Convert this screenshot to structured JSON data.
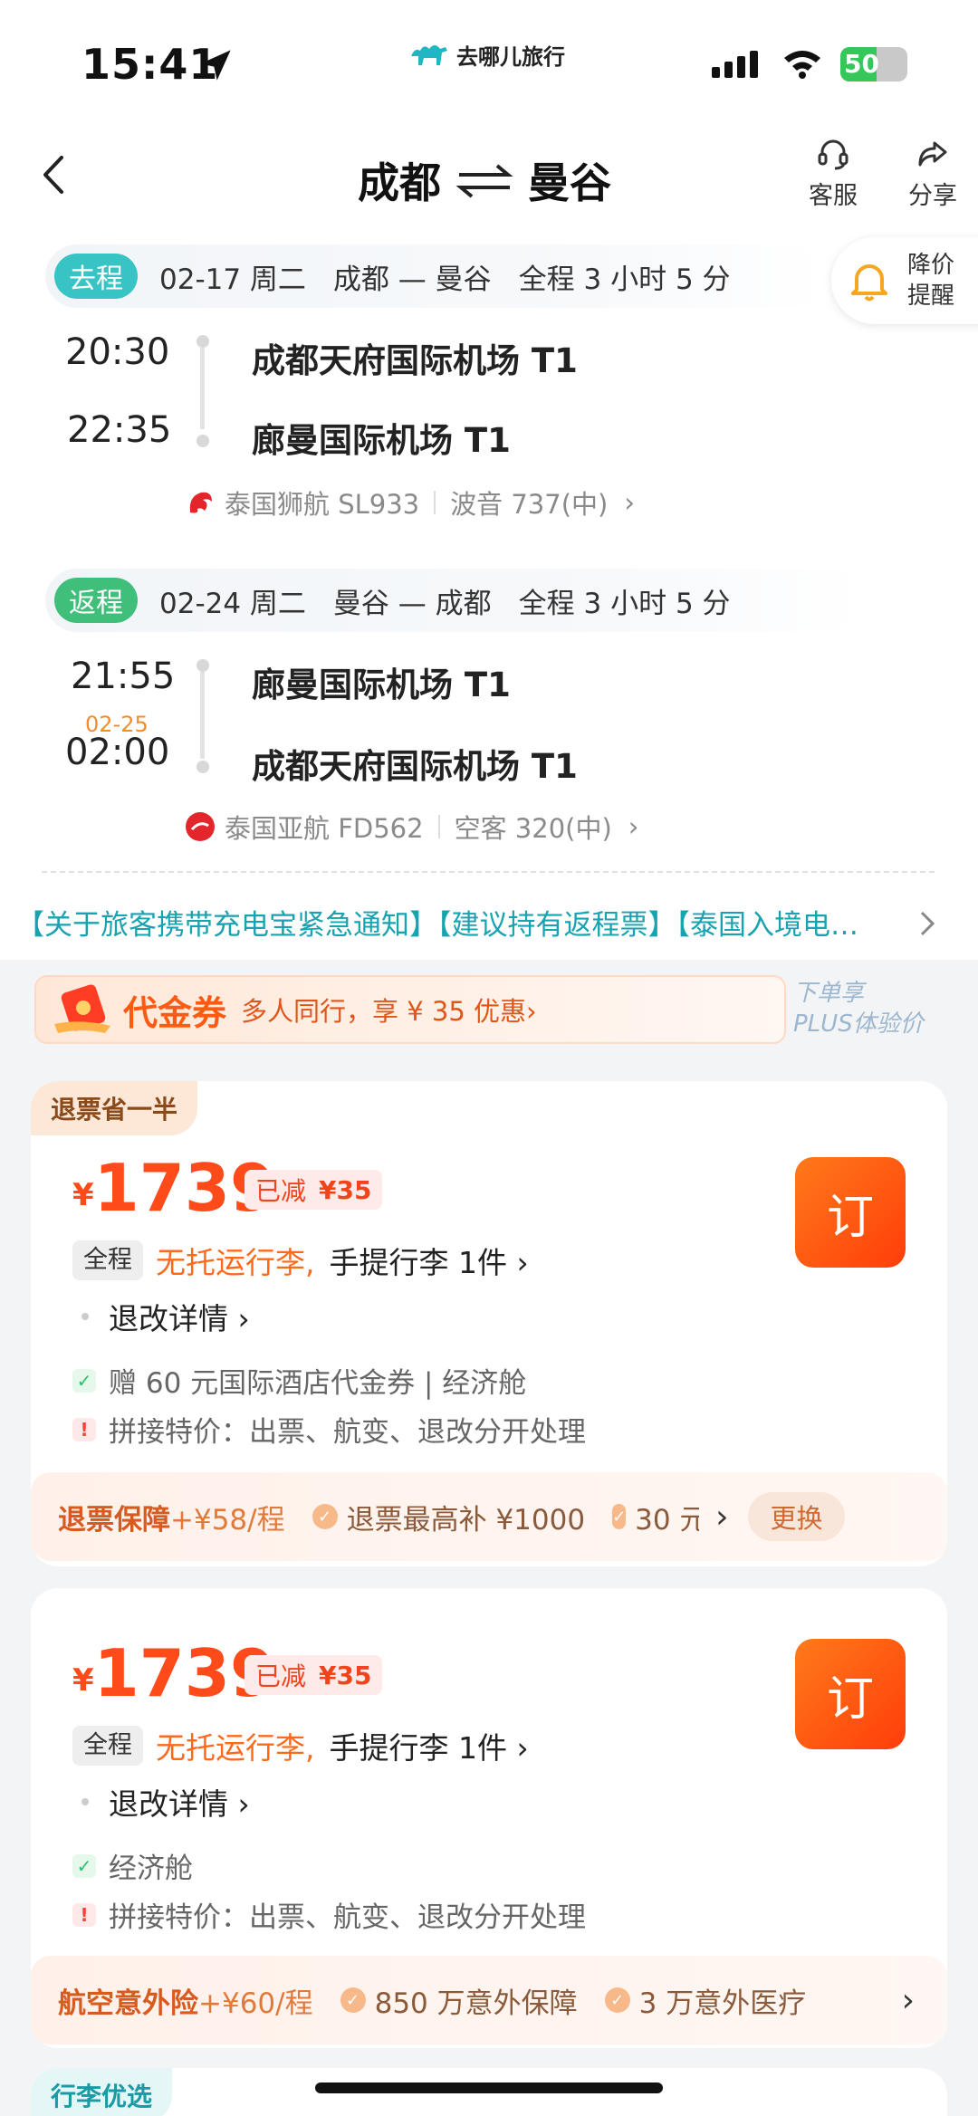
{
  "status_bar": {
    "time": "15:41",
    "logo_text": "去哪儿旅行",
    "battery": "50"
  },
  "header": {
    "from": "成都",
    "to": "曼谷",
    "service_label": "客服",
    "share_label": "分享"
  },
  "price_alert": {
    "line1": "降价",
    "line2": "提醒"
  },
  "outbound": {
    "tag": "去程",
    "date": "02-17 周二",
    "route": "成都 — 曼谷",
    "duration": "全程 3 小时 5 分",
    "dep_time": "20:30",
    "dep_airport": "成都天府国际机场 T1",
    "arr_time": "22:35",
    "arr_airport": "廊曼国际机场 T1",
    "airline": "泰国狮航 SL933",
    "aircraft": "波音 737(中)"
  },
  "return": {
    "tag": "返程",
    "date": "02-24 周二",
    "route": "曼谷 — 成都",
    "duration": "全程 3 小时 5 分",
    "dep_time": "21:55",
    "dep_airport": "廊曼国际机场 T1",
    "arr_date": "02-25",
    "arr_time": "02:00",
    "arr_airport": "成都天府国际机场 T1",
    "airline": "泰国亚航 FD562",
    "aircraft": "空客 320(中)"
  },
  "notice": "【关于旅客携带充电宝紧急通知】【建议持有返程票】【泰国入境电…",
  "voucher": {
    "title": "代金券",
    "desc": "多人同行，享 ¥ 35 优惠›",
    "plus_line1": "下单享",
    "plus_line2": "PLUS体验价"
  },
  "cards": [
    {
      "tag": "退票省一半",
      "currency": "¥",
      "price": "1739",
      "discount_label": "已减",
      "discount_value": "¥35",
      "book": "订",
      "scope": "全程",
      "no_checked": "无托运行李,",
      "carry_on": "手提行李 1件 ›",
      "refund": "退改详情 ›",
      "feature": "赠 60 元国际酒店代金券 | 经济舱",
      "warning": "拼接特价：出票、航变、退改分开处理",
      "ins_name": "退票保障",
      "ins_price": "+¥58/程",
      "ins_item1": "退票最高补 ¥1000",
      "ins_item2": "30 元",
      "ins_action": "更换"
    },
    {
      "currency": "¥",
      "price": "1739",
      "discount_label": "已减",
      "discount_value": "¥35",
      "book": "订",
      "scope": "全程",
      "no_checked": "无托运行李,",
      "carry_on": "手提行李 1件 ›",
      "refund": "退改详情 ›",
      "feature": "经济舱",
      "warning": "拼接特价：出票、航变、退改分开处理",
      "ins_name": "航空意外险",
      "ins_price": "+¥60/程",
      "ins_item1": "850 万意外保障",
      "ins_item2": "3 万意外医疗"
    }
  ],
  "third_card_tag": "行李优选",
  "colors": {
    "accent": "#ff4a1a",
    "teal": "#38c4c4",
    "notice": "#18a3b0"
  }
}
